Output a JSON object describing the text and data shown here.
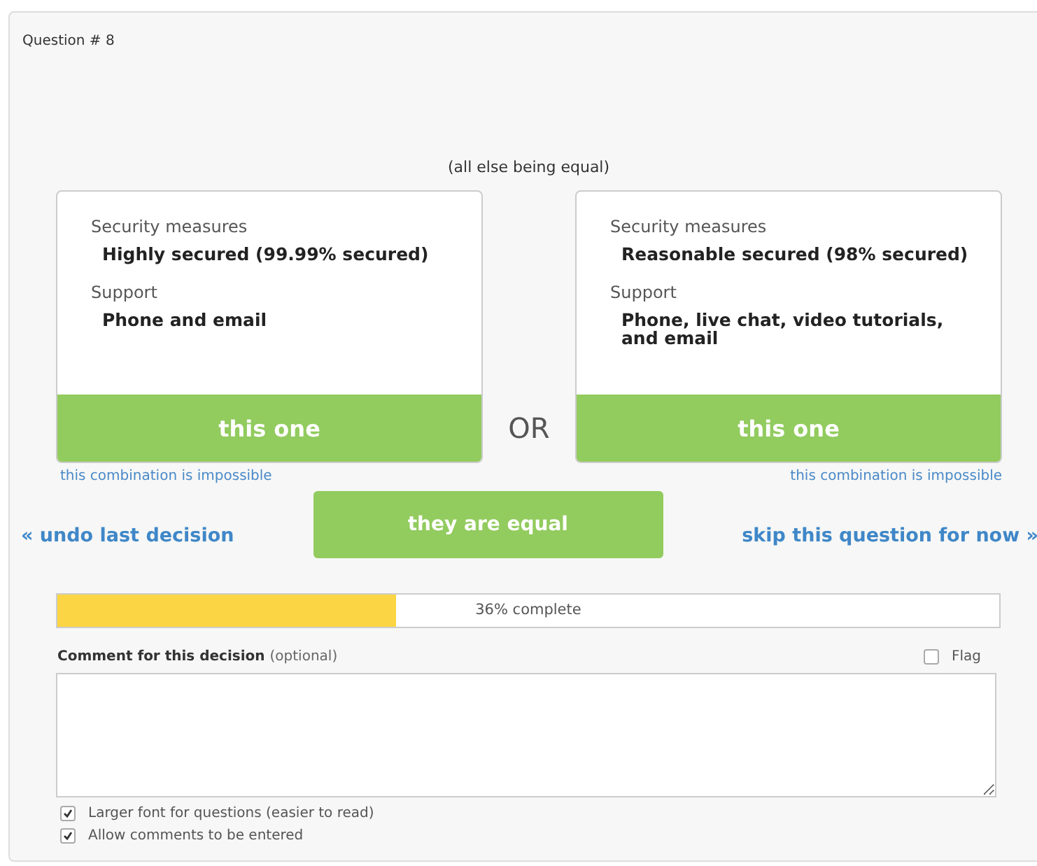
{
  "question_label": "Question # 8",
  "subtitle": "(all else being equal)",
  "options": [
    {
      "attributes": [
        {
          "name": "Security measures",
          "value": "Highly secured (99.99% secured)"
        },
        {
          "name": "Support",
          "value": "Phone and email"
        }
      ],
      "choose_label": "this one",
      "impossible_link": "this combination is impossible"
    },
    {
      "attributes": [
        {
          "name": "Security measures",
          "value": "Reasonable secured (98% secured)"
        },
        {
          "name": "Support",
          "value": "Phone, live chat, video tutorials, and email"
        }
      ],
      "choose_label": "this one",
      "impossible_link": "this combination is impossible"
    }
  ],
  "or_label": "OR",
  "undo_link": "« undo last decision",
  "equal_button": "they are equal",
  "skip_link": "skip this question for now »",
  "progress": {
    "level": 0.36,
    "label": "36% complete"
  },
  "comment": {
    "label": "Comment for this decision",
    "hint": "(optional)"
  },
  "flag": {
    "label": "Flag",
    "checked": false
  },
  "settings": [
    {
      "label": "Larger font for questions (easier to read)",
      "checked": true
    },
    {
      "label": "Allow comments to be entered",
      "checked": true
    }
  ]
}
